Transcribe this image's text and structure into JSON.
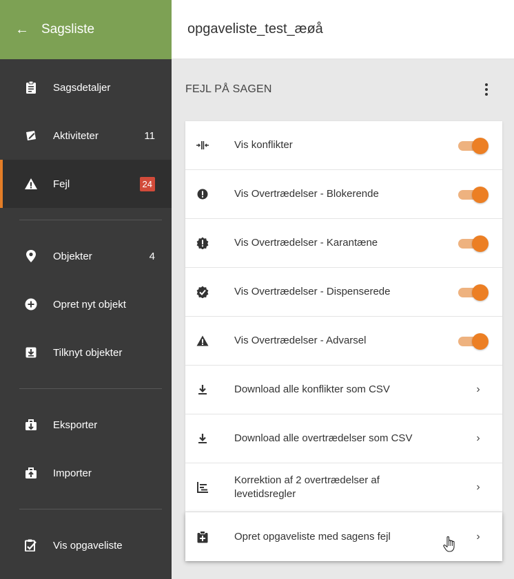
{
  "sidebar": {
    "header": {
      "back_icon": "arrow-left-icon",
      "title": "Sagsliste"
    },
    "items": [
      {
        "label": "Sagsdetaljer",
        "icon": "clipboard-icon"
      },
      {
        "label": "Aktiviteter",
        "icon": "edit-note-icon",
        "count": "11"
      },
      {
        "label": "Fejl",
        "icon": "warning-icon",
        "badge": "24",
        "active": true
      },
      {
        "label": "Objekter",
        "icon": "map-pin-icon",
        "count": "4"
      },
      {
        "label": "Opret nyt objekt",
        "icon": "add-circle-icon"
      },
      {
        "label": "Tilknyt objekter",
        "icon": "download-box-icon"
      },
      {
        "label": "Eksporter",
        "icon": "export-icon"
      },
      {
        "label": "Importer",
        "icon": "import-icon"
      },
      {
        "label": "Vis opgaveliste",
        "icon": "task-list-icon"
      }
    ]
  },
  "topbar": {
    "title": "opgaveliste_test_æøå"
  },
  "main": {
    "section_title": "FEJL PÅ SAGEN",
    "rows": [
      {
        "label": "Vis konflikter",
        "icon": "conflict-icon",
        "type": "toggle",
        "on": true
      },
      {
        "label": "Vis Overtrædelser - Blokerende",
        "icon": "error-circle-icon",
        "type": "toggle",
        "on": true
      },
      {
        "label": "Vis Overtrædelser - Karantæne",
        "icon": "error-badge-icon",
        "type": "toggle",
        "on": true
      },
      {
        "label": "Vis Overtrædelser - Dispenserede",
        "icon": "check-badge-icon",
        "type": "toggle",
        "on": true
      },
      {
        "label": "Vis Overtrædelser - Advarsel",
        "icon": "warning-icon",
        "type": "toggle",
        "on": true
      },
      {
        "label": "Download alle konflikter som CSV",
        "icon": "download-icon",
        "type": "link"
      },
      {
        "label": "Download alle overtrædelser som CSV",
        "icon": "download-icon",
        "type": "link"
      },
      {
        "label": "Korrektion af 2 overtrædelser af levetidsregler",
        "icon": "timeline-icon",
        "type": "link"
      },
      {
        "label": "Opret opgaveliste med sagens fejl",
        "icon": "clipboard-add-icon",
        "type": "link",
        "hover": true
      }
    ]
  },
  "colors": {
    "sidebar_bg": "#3a3a3a",
    "header_green": "#7da154",
    "accent_orange": "#ec7f24",
    "badge_red": "#d24b3a",
    "main_bg": "#e8e8e8"
  }
}
